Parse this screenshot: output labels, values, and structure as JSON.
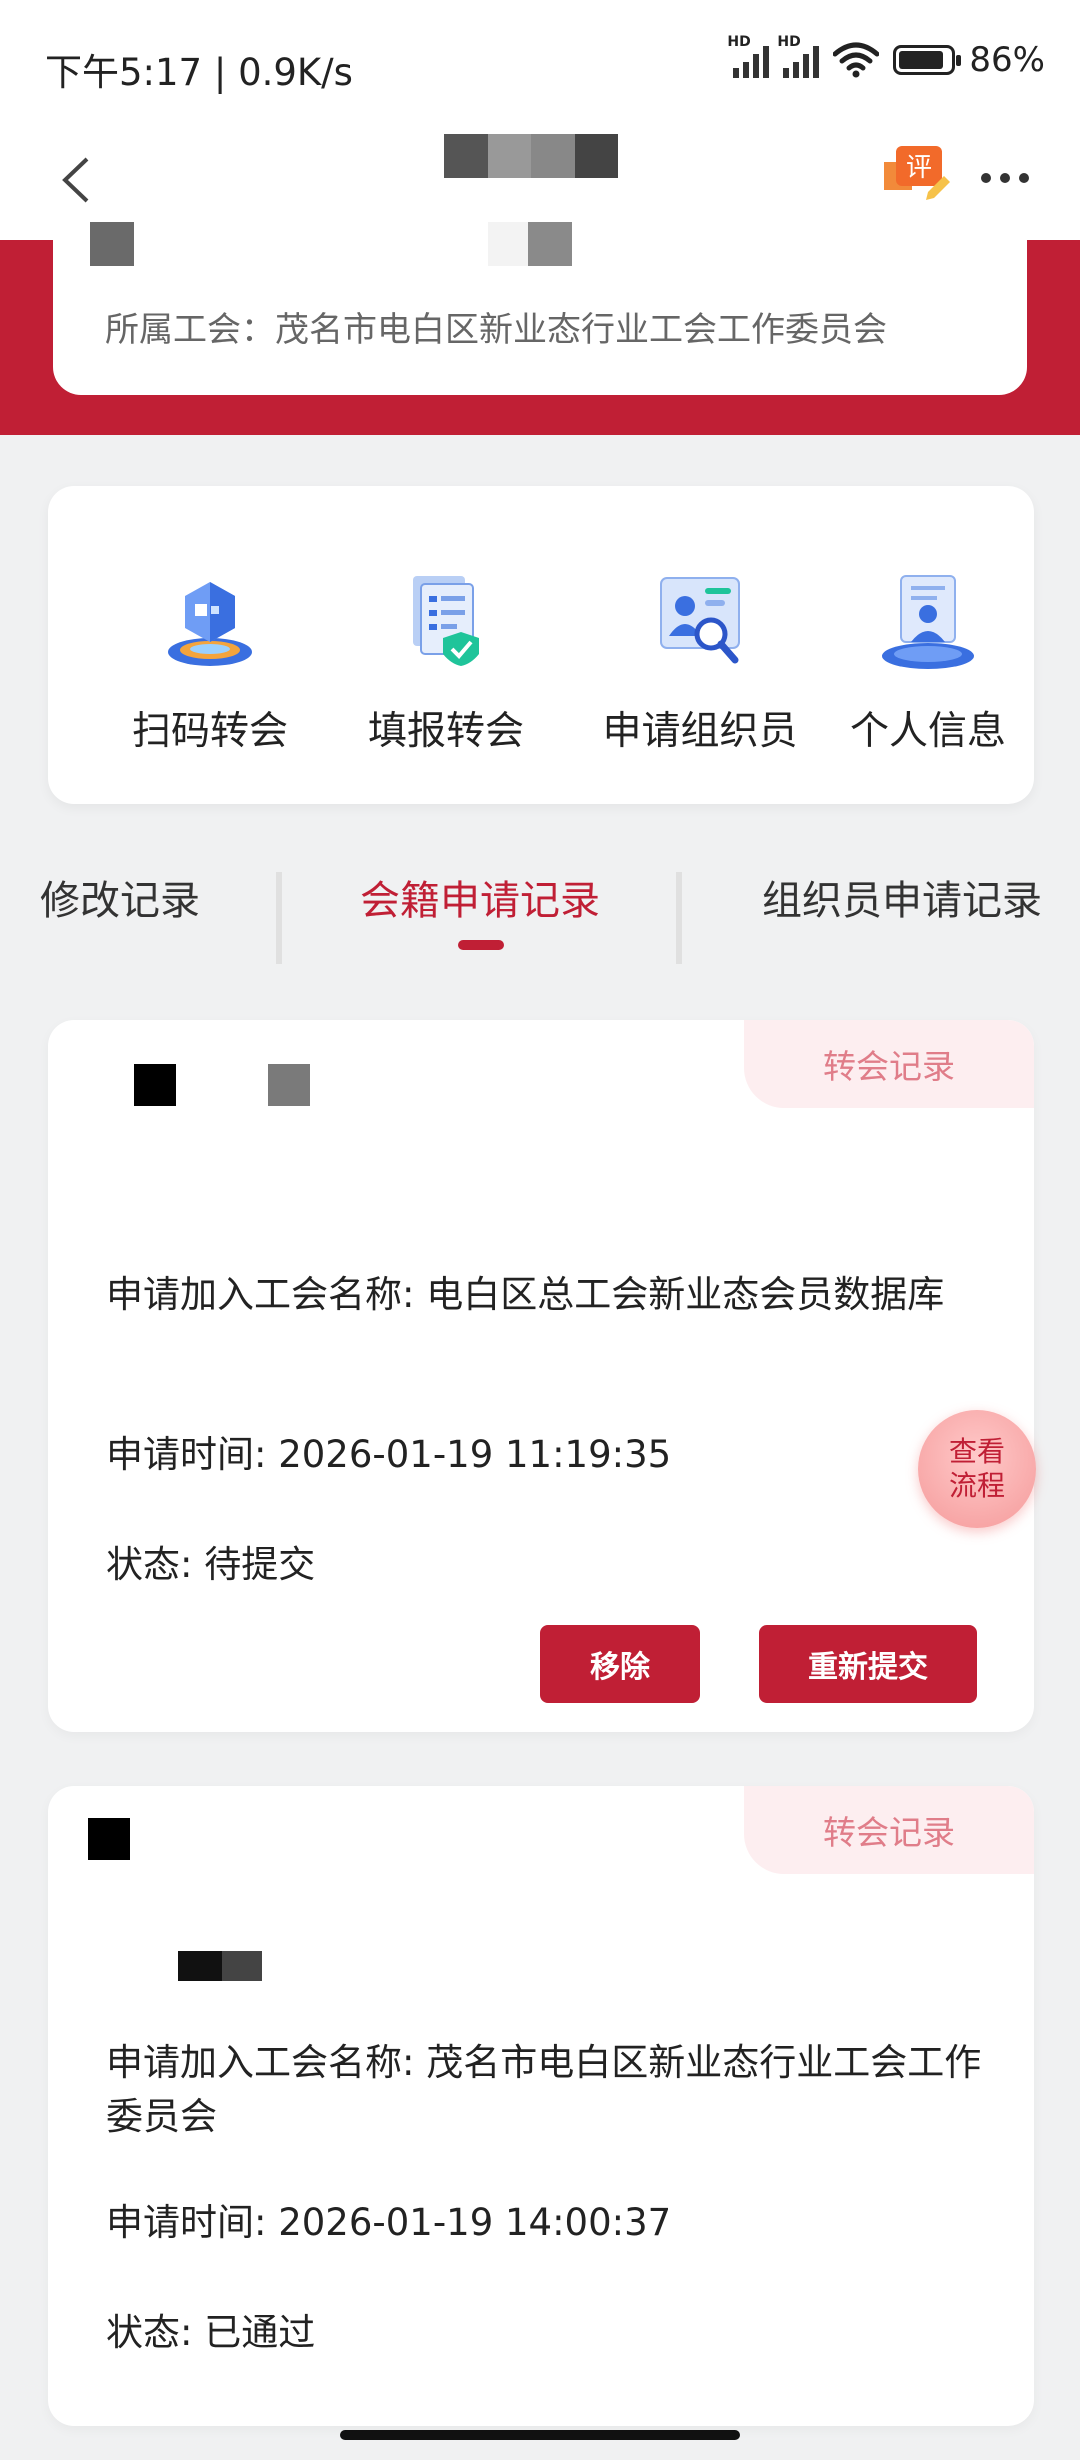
{
  "status_bar": {
    "time": "下午5:17 | 0.9K/s",
    "battery": "86%",
    "signal_label": "HD"
  },
  "nav": {
    "back_icon": "back-chevron-icon",
    "rate_icon": "评",
    "more_icon": "more-dots-icon"
  },
  "member": {
    "union_label": "所属工会：茂名市电白区新业态行业工会工作委员会"
  },
  "actions": [
    {
      "label": "扫码转会",
      "icon": "scan-transfer-icon"
    },
    {
      "label": "填报转会",
      "icon": "form-transfer-icon"
    },
    {
      "label": "申请组织员",
      "icon": "apply-organizer-icon"
    },
    {
      "label": "个人信息",
      "icon": "personal-info-icon"
    }
  ],
  "tabs": [
    {
      "label": "修改记录",
      "active": false
    },
    {
      "label": "会籍申请记录",
      "active": true
    },
    {
      "label": "组织员申请记录",
      "active": false
    }
  ],
  "records": [
    {
      "tag": "转会记录",
      "union_name": "申请加入工会名称: 电白区总工会新业态会员数据库",
      "time": "申请时间: 2026-01-19 11:19:35",
      "status": "状态: 待提交",
      "remove_label": "移除",
      "resubmit_label": "重新提交"
    },
    {
      "tag": "转会记录",
      "union_name": "申请加入工会名称: 茂名市电白区新业态行业工会工作委员会",
      "time": "申请时间: 2026-01-19 14:00:37",
      "status": "状态: 已通过"
    }
  ],
  "fab": {
    "label": "查看流程"
  },
  "colors": {
    "brand_red": "#c01f35",
    "tag_bg": "#fdeef0",
    "tag_text": "#e07d89"
  }
}
